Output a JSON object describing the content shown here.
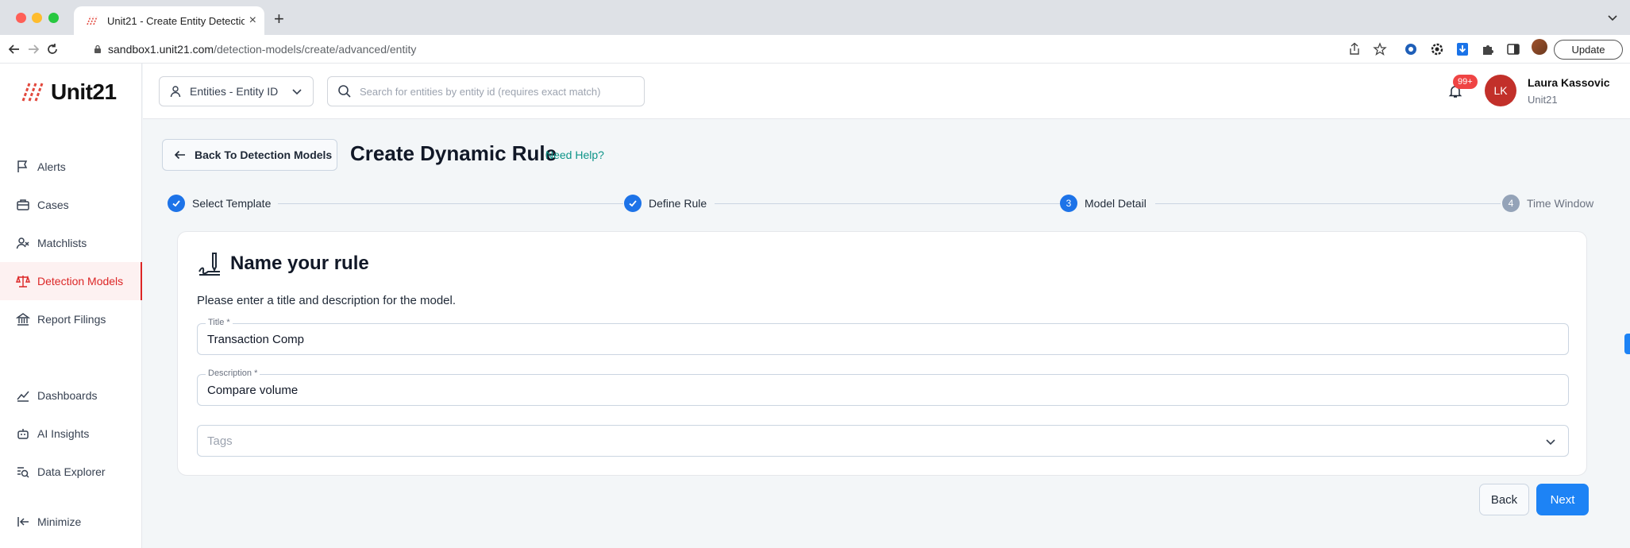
{
  "browser": {
    "tab_title": "Unit21 - Create Entity Detectio",
    "url_host": "sandbox1.unit21.com",
    "url_path": "/detection-models/create/advanced/entity",
    "update_label": "Update"
  },
  "sidebar": {
    "logo_text": "Unit21",
    "items": [
      {
        "label": "Alerts",
        "icon": "flag-icon"
      },
      {
        "label": "Cases",
        "icon": "briefcase-icon"
      },
      {
        "label": "Matchlists",
        "icon": "user-x-icon"
      },
      {
        "label": "Detection Models",
        "icon": "scale-icon",
        "active": true
      },
      {
        "label": "Report Filings",
        "icon": "bank-icon"
      },
      {
        "label": "Dashboards",
        "icon": "chart-line-icon"
      },
      {
        "label": "AI Insights",
        "icon": "robot-icon"
      },
      {
        "label": "Data Explorer",
        "icon": "search-list-icon"
      },
      {
        "label": "Minimize",
        "icon": "collapse-icon"
      }
    ]
  },
  "header": {
    "entity_select": "Entities - Entity ID",
    "search_placeholder": "Search for entities by entity id (requires exact match)",
    "notif_count": "99+",
    "avatar_initials": "LK",
    "user_name": "Laura Kassovic",
    "user_org": "Unit21"
  },
  "page": {
    "back_label": "Back To Detection Models",
    "title": "Create Dynamic Rule",
    "help": "Need Help?"
  },
  "stepper": {
    "steps": [
      {
        "label": "Select Template",
        "state": "done"
      },
      {
        "label": "Define Rule",
        "state": "done"
      },
      {
        "label": "Model Detail",
        "state": "current",
        "number": "3"
      },
      {
        "label": "Time Window",
        "state": "todo",
        "number": "4"
      }
    ]
  },
  "card": {
    "title": "Name your rule",
    "description": "Please enter a title and description for the model.",
    "title_label": "Title *",
    "title_value": "Transaction Comp",
    "desc_label": "Description *",
    "desc_value": "Compare volume",
    "tags_placeholder": "Tags"
  },
  "actions": {
    "back": "Back",
    "next": "Next"
  },
  "colors": {
    "primary": "#1d83f5",
    "active_nav": "#dc2626",
    "avatar": "#c2302a",
    "help_link": "#0d9488"
  }
}
